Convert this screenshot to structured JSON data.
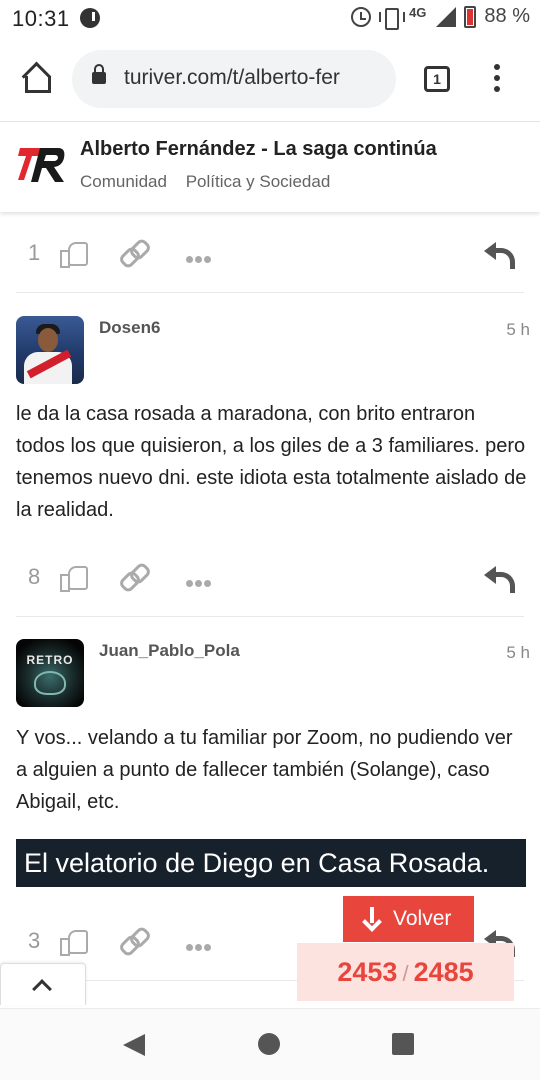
{
  "status_bar": {
    "time": "10:31",
    "network": "4G",
    "battery": "88 %"
  },
  "browser": {
    "url": "turiver.com/t/alberto-fer",
    "tab_count": "1"
  },
  "site_header": {
    "topic_title": "Alberto Fernández - La saga continúa",
    "breadcrumbs": [
      "Comunidad",
      "Política y Sociedad"
    ]
  },
  "posts": [
    {
      "likes": "1"
    },
    {
      "username": "Dosen6",
      "date": "5 h",
      "body": "le da la casa rosada a maradona, con brito entraron todos los que quisieron, a los giles de a 3 familiares. pero tenemos nuevo dni. este idiota esta totalmente aislado de la realidad.",
      "likes": "8"
    },
    {
      "username": "Juan_Pablo_Pola",
      "date": "5 h",
      "avatar_text": "RETRO",
      "body": "Y vos... velando a tu familiar por Zoom, no pudiendo ver a alguien a punto de fallecer también (Solange), caso Abigail, etc.",
      "embed_title": "El velatorio de Diego en Casa Rosada.",
      "likes": "3"
    }
  ],
  "timeline": {
    "back_label": "Volver",
    "current": "2453",
    "separator": "/",
    "total": "2485"
  },
  "colors": {
    "accent": "#e8453c",
    "progress_bg": "#fde3df",
    "embed_bg": "#17212b",
    "logo_red": "#e0282e"
  },
  "icons": [
    "home-icon",
    "lock-icon",
    "tabs-icon",
    "menu-icon",
    "like-icon",
    "link-icon",
    "more-icon",
    "reply-icon",
    "arrow-down-icon",
    "chevron-up-icon"
  ]
}
